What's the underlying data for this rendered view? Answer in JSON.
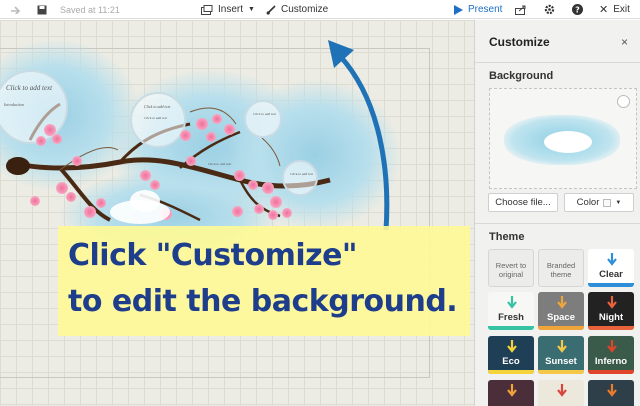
{
  "toolbar": {
    "saved_text": "Saved at 11:21",
    "insert_label": "Insert",
    "customize_label": "Customize",
    "present_label": "Present",
    "exit_label": "Exit"
  },
  "canvas": {
    "bubbles": [
      {
        "title": "Click to add text",
        "subtitle": "Introduction"
      },
      {
        "title": "Click to add text",
        "subtitle": "Click to add text"
      },
      {
        "title": "Click to add text",
        "subtitle": ""
      },
      {
        "title": "Click to add text",
        "subtitle": ""
      }
    ],
    "hint_text": "Click to add text"
  },
  "callout": {
    "line1": "Click \"Customize\"",
    "line2": "to edit the background."
  },
  "panel": {
    "title": "Customize",
    "close_label": "×",
    "background_heading": "Background",
    "choose_file_label": "Choose file...",
    "color_label": "Color",
    "theme_heading": "Theme",
    "themes": [
      {
        "name": "Revert to original",
        "bg": "#ececea",
        "fg": "#666"
      },
      {
        "name": "Branded theme",
        "bg": "#ececea",
        "fg": "#666"
      },
      {
        "name": "Clear",
        "bg": "#ffffff",
        "fg": "#333",
        "accent": "#2e8fd8"
      },
      {
        "name": "Fresh",
        "bg": "#f7f7f5",
        "fg": "#333",
        "accent": "#35c4a3"
      },
      {
        "name": "Space",
        "bg": "#7d7d7d",
        "fg": "#ffffff",
        "accent": "#f0a53a"
      },
      {
        "name": "Night",
        "bg": "#222222",
        "fg": "#ffffff",
        "accent": "#e8623c"
      },
      {
        "name": "Eco",
        "bg": "#1f3f57",
        "fg": "#ffffff",
        "accent": "#f5d33a"
      },
      {
        "name": "Sunset",
        "bg": "#3a6d72",
        "fg": "#ffffff",
        "accent": "#f5c84a"
      },
      {
        "name": "Inferno",
        "bg": "#3a5a4a",
        "fg": "#ffffff",
        "accent": "#e0452c"
      },
      {
        "name": "",
        "bg": "#4a2f3a",
        "fg": "#ffffff",
        "accent": "#f3a23a"
      },
      {
        "name": "",
        "bg": "#ece8dc",
        "fg": "#333",
        "accent": "#d8433a"
      },
      {
        "name": "",
        "bg": "#2f3f4a",
        "fg": "#ffffff",
        "accent": "#ea7c2c"
      }
    ]
  }
}
